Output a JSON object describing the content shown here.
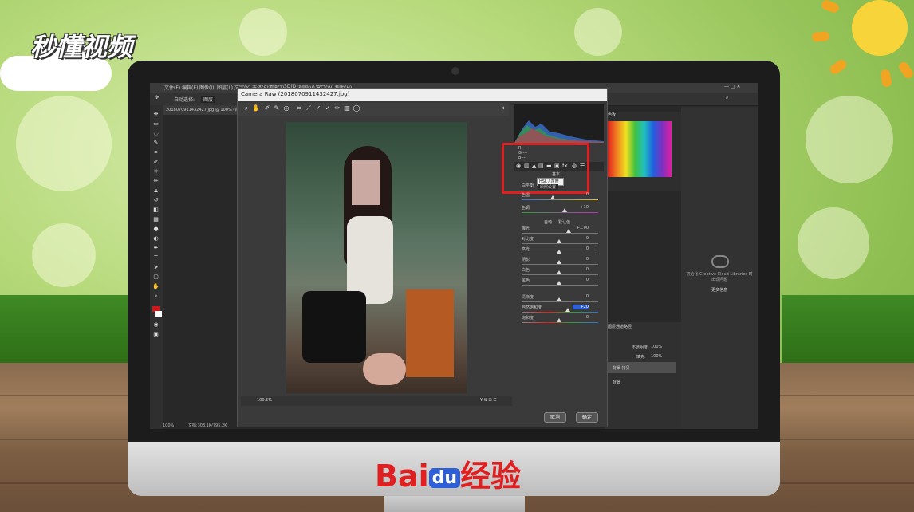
{
  "watermark": {
    "logo_text": "秒懂视频"
  },
  "branding": {
    "baidu_left": "Bai",
    "baidu_du": "du",
    "baidu_right": "经验"
  },
  "ps": {
    "menu": [
      "文件(F)",
      "编辑(E)",
      "图像(I)",
      "图层(L)",
      "文字(Y)",
      "选择(S)",
      "滤镜(T)",
      "3D(D)",
      "视图(V)",
      "窗口(W)",
      "帮助(H)"
    ],
    "options_label": "自动选择:",
    "options_select": "图层",
    "doc_tab": "20180709114324​27.jpg @ 100% (背景, 灰...",
    "status_zoom": "100%",
    "status_doc": "文档:303.1K/795.2K",
    "panel_swatches_title": "色板",
    "libraries_hint": "初始化 Creative Cloud Libraries 时出现问题",
    "libraries_more": "更多信息",
    "layers_title_1": "图层",
    "layers_title_2": "通道",
    "layers_title_3": "路径",
    "layer_opacity_label": "不透明度:",
    "layer_opacity": "100%",
    "layer_fill_label": "填充:",
    "layer_fill": "100%",
    "layer_1": "背景 拷贝",
    "layer_2": "背景"
  },
  "camera_raw": {
    "title": "Camera Raw (20180709114324​27.jpg)",
    "zoom": "100.5%",
    "tooltip": "HSL / 灰度",
    "panel_title": "基本",
    "wb_label": "白平衡:",
    "wb_value": "原照设置",
    "temp_label": "色温",
    "temp_value": "0",
    "tint_label": "色调",
    "tint_value": "+10",
    "auto_label": "自动",
    "default_label": "默认值",
    "sliders": [
      {
        "label": "曝光",
        "value": "+1.00"
      },
      {
        "label": "对比度",
        "value": "0"
      },
      {
        "label": "高光",
        "value": "0"
      },
      {
        "label": "阴影",
        "value": "0"
      },
      {
        "label": "白色",
        "value": "0"
      },
      {
        "label": "黑色",
        "value": "0"
      },
      {
        "label": "清晰度",
        "value": "0"
      },
      {
        "label": "自然饱和度",
        "value": "+20"
      },
      {
        "label": "饱和度",
        "value": "0"
      }
    ],
    "cancel_label": "取消",
    "ok_label": "确定",
    "highlight_color": "#e02020"
  }
}
